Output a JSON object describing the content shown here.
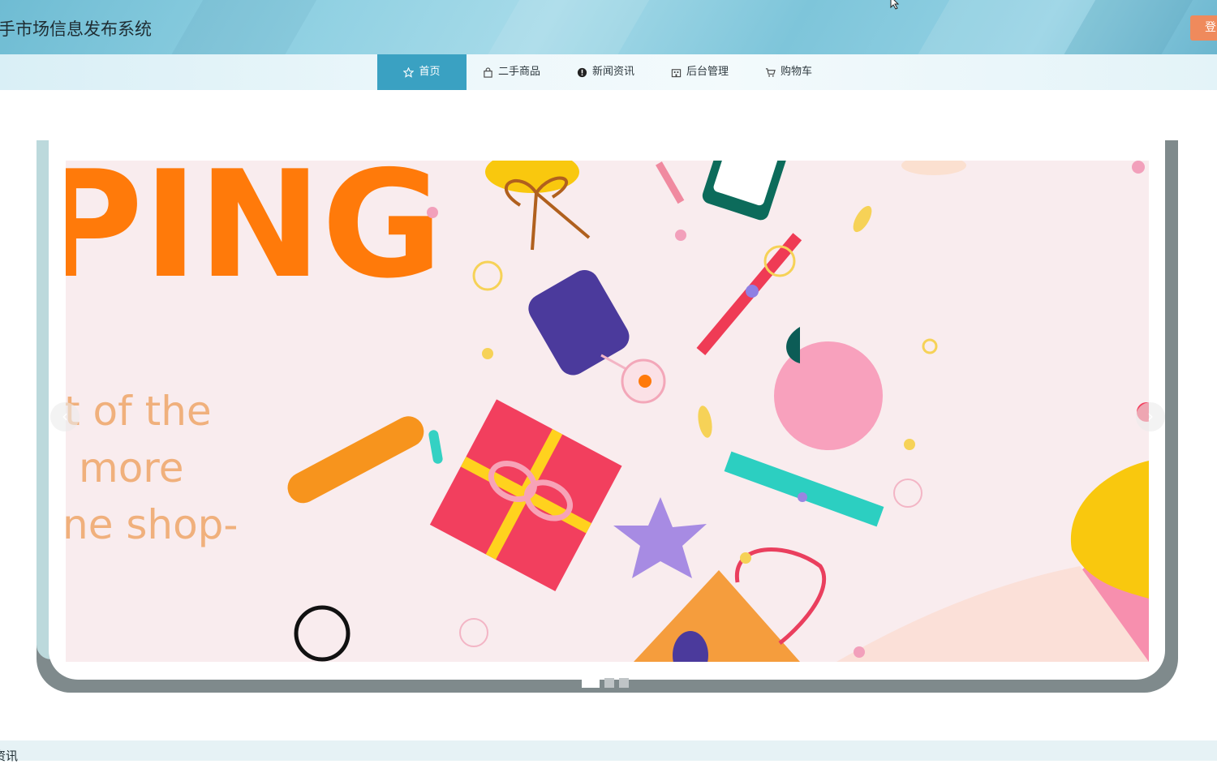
{
  "header": {
    "title": "手市场信息发布系统",
    "login_label": "登"
  },
  "nav": {
    "items": [
      {
        "label": "首页",
        "icon": "star-icon",
        "active": true
      },
      {
        "label": "二手商品",
        "icon": "bag-icon",
        "active": false
      },
      {
        "label": "新闻资讯",
        "icon": "info-icon",
        "active": false
      },
      {
        "label": "后台管理",
        "icon": "building-icon",
        "active": false
      },
      {
        "label": "购物车",
        "icon": "cart-icon",
        "active": false
      }
    ]
  },
  "banner": {
    "headline": "PING",
    "line1": "t of the",
    "line2": "more",
    "line3": "ne shop-",
    "slide_count": 3,
    "current_slide": 1
  },
  "footer": {
    "section_label": "资讯"
  },
  "colors": {
    "accent": "#3aa1c2",
    "login": "#ef8a5c",
    "headline": "#ff7a0a"
  }
}
